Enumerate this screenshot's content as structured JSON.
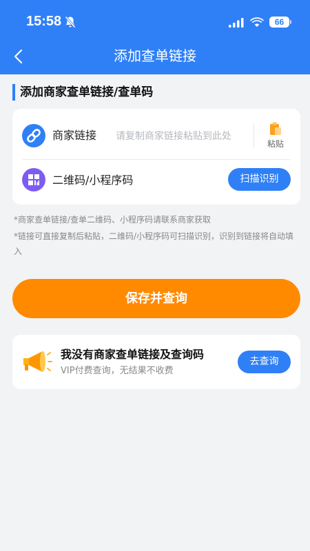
{
  "status_bar": {
    "time": "15:58",
    "battery": "66"
  },
  "header": {
    "title": "添加查单链接"
  },
  "section": {
    "title": "添加商家查单链接/查单码"
  },
  "form": {
    "merchant_link_label": "商家链接",
    "merchant_link_value": "",
    "merchant_link_placeholder": "请复制商家链接粘贴到此处",
    "paste_label": "粘贴",
    "qr_label": "二维码/小程序码",
    "scan_button": "扫描识别"
  },
  "notes": [
    "*商家查单链接/查单二维码、小程序码请联系商家获取",
    "*链接可直接复制后粘贴，二维码/小程序码可扫描识别，识别到链接将自动填入"
  ],
  "save_button": "保存并查询",
  "vip": {
    "title": "我没有商家查单链接及查询码",
    "subtitle": "VIP付费查询，无结果不收费",
    "button": "去查询"
  },
  "icons": {
    "bell": "bell-muted-icon",
    "signal": "cellular-signal-icon",
    "wifi": "wifi-icon",
    "back": "chevron-left-icon",
    "link": "link-icon",
    "qr": "grid-icon",
    "paste": "clipboard-icon",
    "megaphone": "megaphone-icon"
  },
  "colors": {
    "primary": "#2f80f6",
    "accent": "#ff8a00",
    "qr_icon_bg": "#7d5cf2",
    "background": "#f2f3f5"
  }
}
